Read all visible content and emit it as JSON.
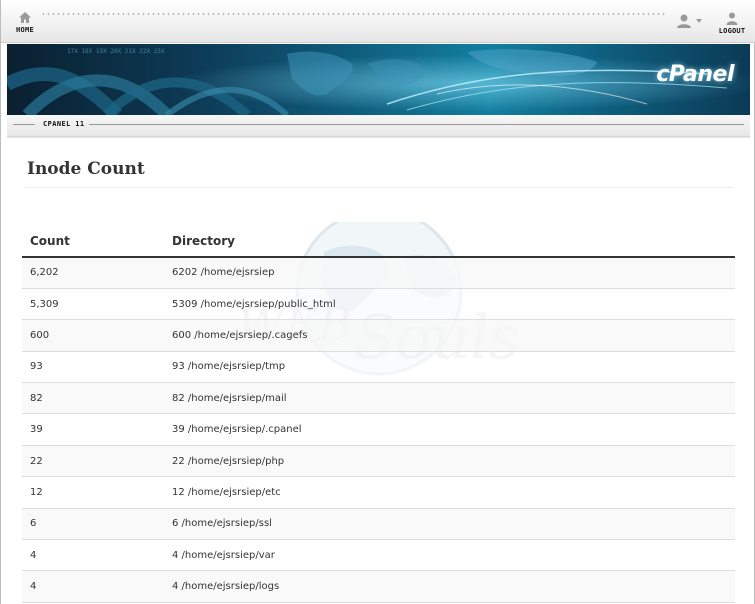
{
  "topbar": {
    "home_label": "HOME",
    "logout_label": "LOGOUT"
  },
  "version": {
    "label": "CPANEL 11"
  },
  "banner": {
    "brand": "cPanel"
  },
  "page": {
    "title": "Inode Count"
  },
  "table": {
    "headers": {
      "count": "Count",
      "directory": "Directory"
    },
    "rows": [
      {
        "count": "6,202",
        "directory": "6202 /home/ejsrsiep"
      },
      {
        "count": "5,309",
        "directory": "5309 /home/ejsrsiep/public_html"
      },
      {
        "count": "600",
        "directory": "600 /home/ejsrsiep/.cagefs"
      },
      {
        "count": "93",
        "directory": "93 /home/ejsrsiep/tmp"
      },
      {
        "count": "82",
        "directory": "82 /home/ejsrsiep/mail"
      },
      {
        "count": "39",
        "directory": "39 /home/ejsrsiep/.cpanel"
      },
      {
        "count": "22",
        "directory": "22 /home/ejsrsiep/php"
      },
      {
        "count": "12",
        "directory": "12 /home/ejsrsiep/etc"
      },
      {
        "count": "6",
        "directory": "6 /home/ejsrsiep/ssl"
      },
      {
        "count": "4",
        "directory": "4 /home/ejsrsiep/var"
      },
      {
        "count": "4",
        "directory": "4 /home/ejsrsiep/logs"
      }
    ]
  },
  "watermark": {
    "text_left": "WEB",
    "text_right": "Souls"
  },
  "colors": {
    "banner_dark": "#0a2030",
    "banner_light": "#127fa0",
    "header_rule": "#333333"
  },
  "icons": {
    "home": "home-icon",
    "user": "user-icon",
    "caret": "caret-down-icon",
    "logout": "logout-icon"
  }
}
